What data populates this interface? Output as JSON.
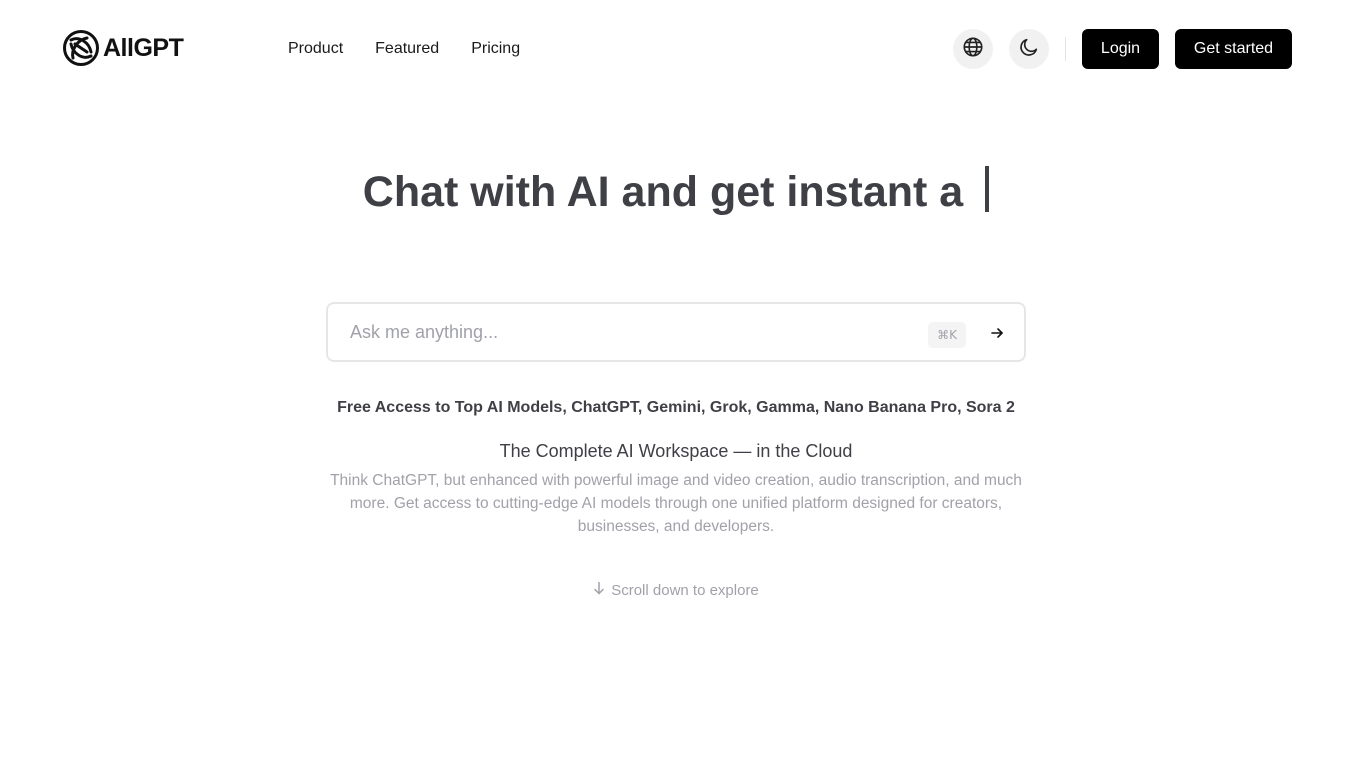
{
  "header": {
    "brand_name": "AllGPT",
    "nav": [
      {
        "label": "Product"
      },
      {
        "label": "Featured"
      },
      {
        "label": "Pricing"
      }
    ],
    "language_icon": "globe-icon",
    "theme_icon": "moon-icon",
    "login_label": "Login",
    "get_started_label": "Get started"
  },
  "hero": {
    "title": "Chat with AI and get instant a"
  },
  "search": {
    "placeholder": "Ask me anything...",
    "value": "",
    "shortcut": "⌘K",
    "submit_icon": "arrow-right-icon"
  },
  "info": {
    "models_line": "Free Access to Top AI Models, ChatGPT, Gemini, Grok, Gamma, Nano Banana Pro, Sora 2",
    "subtitle": "The Complete AI Workspace — in the Cloud",
    "description": "Think ChatGPT, but enhanced with powerful image and video creation, audio transcription, and much more. Get access to cutting-edge AI models through one unified platform designed for creators, businesses, and developers."
  },
  "scroll_hint": {
    "label": "Scroll down to explore",
    "icon": "arrow-down-icon"
  },
  "colors": {
    "primary_button": "#000000",
    "heading_text": "#3f3f46",
    "muted_text": "#a1a1aa",
    "icon_button_bg": "#f1f1f1"
  }
}
